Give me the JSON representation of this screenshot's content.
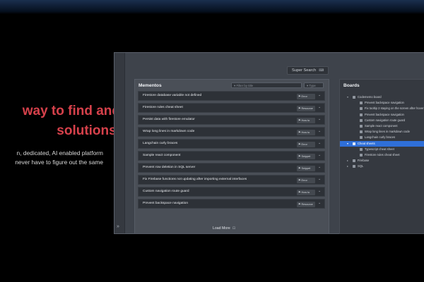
{
  "hero": {
    "heading_line1": "way to find and",
    "heading_line2": "solutions.",
    "sub_line1": "n, dedicated, AI enabled platform",
    "sub_line2": "never have to figure out the same"
  },
  "toolbar": {
    "super_search_label": "Super Search",
    "super_search_icon": "keyboard-icon"
  },
  "mementos": {
    "title": "Mementos",
    "filter_placeholder": "Filter by title",
    "type_label": "Type",
    "items": [
      {
        "label": "Firestore database variable not defined",
        "tag": "Error"
      },
      {
        "label": "Firestore rules cheat sheet",
        "tag": "Resource"
      },
      {
        "label": "Persist data with firestore emulator",
        "tag": "How to"
      },
      {
        "label": "Wrap long lines in markdown code",
        "tag": "How to"
      },
      {
        "label": "Langchain curly braces",
        "tag": "Error"
      },
      {
        "label": "Sample react component",
        "tag": "Snippet"
      },
      {
        "label": "Prevent row deletion in SQL server",
        "tag": "Snippet"
      },
      {
        "label": "Fix Firebase functions not updating after importing external interfaces",
        "tag": "Error"
      },
      {
        "label": "Custom navigation route guard",
        "tag": "How to"
      },
      {
        "label": "Prevent backspace navigation",
        "tag": "Resource"
      }
    ],
    "load_more_label": "Load More"
  },
  "boards": {
    "title": "Boards",
    "tree": [
      {
        "label": "Codememo board",
        "level": 0,
        "toggle": "▾",
        "folder": true
      },
      {
        "label": "Prevent backspace navigation",
        "level": 1
      },
      {
        "label": "Fix tooltip 2 staying on the screen after hover out wh",
        "level": 1
      },
      {
        "label": "Prevent backspace navigation",
        "level": 1
      },
      {
        "label": "Custom navigation route guard",
        "level": 1
      },
      {
        "label": "Sample react component",
        "level": 1
      },
      {
        "label": "Wrap long lines in markdown code",
        "level": 1
      },
      {
        "label": "Langchain curly braces",
        "level": 1
      },
      {
        "label": "Cheat sheets",
        "level": 0,
        "toggle": "▾",
        "folder": true,
        "selected": true
      },
      {
        "label": "Typescript cheat sheet",
        "level": 1
      },
      {
        "label": "Firestore rules cheat sheet",
        "level": 1
      },
      {
        "label": "Firebase",
        "level": 0,
        "toggle": "▸",
        "folder": true
      },
      {
        "label": "SQL",
        "level": 0,
        "toggle": "▸",
        "folder": true
      }
    ]
  },
  "colors": {
    "accent_red": "#d6414b",
    "selection_blue": "#2f6fd8"
  }
}
